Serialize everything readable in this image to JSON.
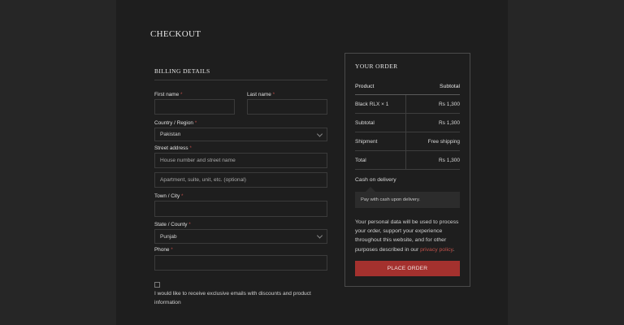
{
  "page": {
    "title": "CHECKOUT"
  },
  "billing": {
    "title": "BILLING DETAILS",
    "required_mark": "*",
    "first_name": {
      "label": "First name",
      "value": ""
    },
    "last_name": {
      "label": "Last name",
      "value": ""
    },
    "country": {
      "label": "Country / Region",
      "value": "Pakistan"
    },
    "street": {
      "label": "Street address",
      "placeholder1": "House number and street name",
      "placeholder2": "Apartment, suite, unit, etc. (optional)"
    },
    "city": {
      "label": "Town / City",
      "value": ""
    },
    "state": {
      "label": "State / County",
      "value": "Punjab"
    },
    "phone": {
      "label": "Phone",
      "value": ""
    },
    "newsletter": "I would like to receive exclusive emails with discounts and product information",
    "newsletter_checked": false
  },
  "order": {
    "title": "YOUR ORDER",
    "headers": {
      "product": "Product",
      "subtotal": "Subtotal"
    },
    "rows": [
      {
        "label": "Black RLX × 1",
        "value": "Rs 1,300"
      },
      {
        "label": "Subtotal",
        "value": "Rs 1,300"
      },
      {
        "label": "Shipment",
        "value": "Free shipping"
      },
      {
        "label": "Total",
        "value": "Rs 1,300"
      }
    ],
    "payment_method": "Cash on delivery",
    "payment_description": "Pay with cash upon delivery.",
    "privacy_text": "Your personal data will be used to process your order, support your experience throughout this website, and for other purposes described in our",
    "privacy_link": "privacy policy",
    "privacy_end": ".",
    "place_order_label": "PLACE ORDER"
  },
  "colors": {
    "background": "#262626",
    "panel": "#1e1e1e",
    "accent": "#a4312e",
    "required": "#b64a46"
  }
}
